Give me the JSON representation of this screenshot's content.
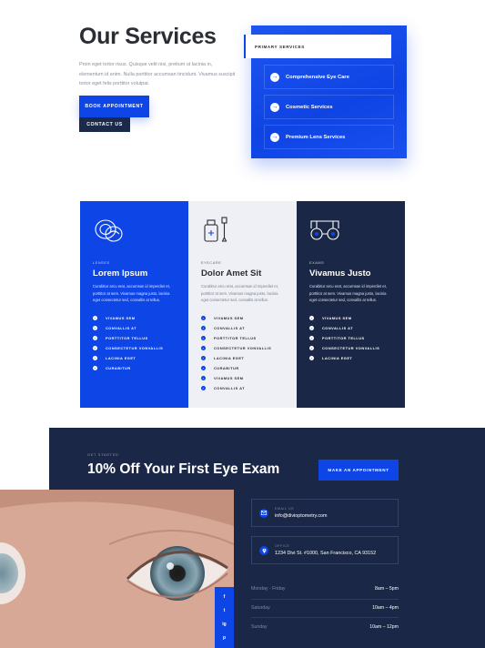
{
  "intro": {
    "title": "Our Services",
    "description": "Proin eget tortor risus. Quisque velit nisi, pretium ut lacinia in, elementum id enim. Nulla porttitor accumsan tincidunt. Vivamus suscipit tortor eget felis porttitor volutpat.",
    "book_label": "BOOK APPOINTMENT",
    "contact_label": "CONTACT US"
  },
  "primary": {
    "tag": "PRIMARY SERVICES",
    "items": [
      "Comprehensive Eye Care",
      "Cosmetic Services",
      "Premium Lens Services"
    ]
  },
  "cards": [
    {
      "kicker": "LENSES",
      "title": "Lorem Ipsum",
      "text": "Curabitur arcu erat, accumsan id imperdiet et, porttitor at sem. Vivamus magna justo, lacinia eget consectetur sed, convallis at tellus.",
      "items": [
        "VIVAMUS SEM",
        "CONVALLIS AT",
        "PORTTITOR TELLUS",
        "CONSECTETUR VONVALLIS",
        "LACINIA EGET",
        "CURABITUR"
      ],
      "icon": "contact-lens-icon"
    },
    {
      "kicker": "EYECARE",
      "title": "Dolor Amet Sit",
      "text": "Curabitur arcu erat, accumsan id imperdiet et, porttitor at sem. Vivamus magna justo, lacinia eget consectetur sed, convallis at tellus.",
      "items": [
        "VIVAMUS SEM",
        "CONVALLIS AT",
        "PORTTITOR TELLUS",
        "CONSECTETUR VONVALLIS",
        "LACINIA EGET",
        "CURABITUR",
        "VIVAMUS SEM",
        "CONVALLIS AT"
      ],
      "icon": "eye-drops-icon"
    },
    {
      "kicker": "EXAMS",
      "title": "Vivamus Justo",
      "text": "Curabitur arcu erat, accumsan id imperdiet et, porttitor at sem. Vivamus magna justo, lacinia eget consectetur sed, convallis at tellus.",
      "items": [
        "VIVAMUS SEM",
        "CONVALLIS AT",
        "PORTTITOR TELLUS",
        "CONSECTETUR VONVALLIS",
        "LACINIA EGET"
      ],
      "icon": "eye-exam-icon"
    }
  ],
  "offer": {
    "kicker": "GET STARTED",
    "title": "10% Off Your First Eye Exam",
    "button_label": "MAKE AN APPOINTMENT"
  },
  "contact": {
    "email_label": "EMAIL US",
    "email": "info@divioptometry.com",
    "office_label": "OFFICE",
    "address": "1234 Divi St. #1000, San Francisco, CA 93152"
  },
  "hours": [
    {
      "day": "Monday - Friday",
      "time": "8am – 5pm"
    },
    {
      "day": "Saturday",
      "time": "10am – 4pm"
    },
    {
      "day": "Sunday",
      "time": "10am – 12pm"
    }
  ],
  "socials": [
    "f",
    "t",
    "ig",
    "p"
  ],
  "colors": {
    "accent": "#0d45e6",
    "navy": "#1b2746",
    "light": "#eef0f6"
  }
}
